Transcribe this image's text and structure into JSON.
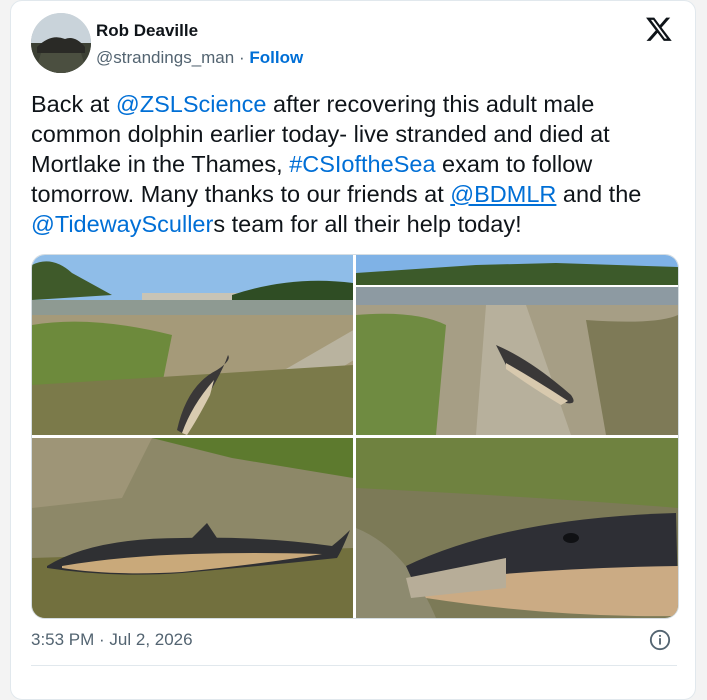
{
  "author": {
    "name": "Rob Deaville",
    "handle": "@strandings_man",
    "separator": "·",
    "follow_label": "Follow"
  },
  "tweet": {
    "parts": [
      {
        "text": "Back at ",
        "kind": "plain"
      },
      {
        "text": "@ZSLScience",
        "kind": "mention"
      },
      {
        "text": " after recovering this adult male common dolphin earlier today- live stranded and died at Mortlake in the Thames, ",
        "kind": "plain"
      },
      {
        "text": "#CSIoftheSea",
        "kind": "mention"
      },
      {
        "text": " exam to follow tomorrow. Many thanks to our friends at ",
        "kind": "plain"
      },
      {
        "text": "@BDMLR",
        "kind": "link"
      },
      {
        "text": " and the ",
        "kind": "plain"
      },
      {
        "text": "@TidewaySculler",
        "kind": "mention"
      },
      {
        "text": "s team for all their help today!",
        "kind": "plain"
      }
    ]
  },
  "media": [
    {
      "name": "photo-dolphin-slipway-bridge"
    },
    {
      "name": "photo-dolphin-slipway-river"
    },
    {
      "name": "photo-dolphin-side-view"
    },
    {
      "name": "photo-dolphin-head-closeup"
    }
  ],
  "footer": {
    "timestamp": "3:53 PM · Jul 2, 2026"
  },
  "icons": {
    "brand": "x-logo-icon",
    "info": "info-icon"
  },
  "colors": {
    "link": "#006fd6",
    "text": "#0f1419",
    "muted": "#536471"
  }
}
